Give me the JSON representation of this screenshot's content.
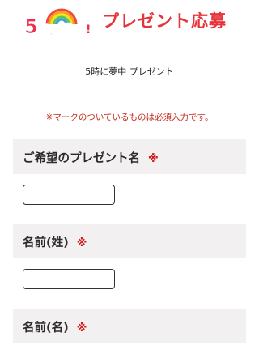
{
  "header": {
    "logo_text": "5時に夢中!",
    "title": "プレゼント応募"
  },
  "program_label": "5時に夢中 プレゼント",
  "notice": "※マークのついているものは必須入力です。",
  "form": {
    "required_mark": "※",
    "sections": [
      {
        "label": "ご希望のプレゼント名",
        "value": ""
      },
      {
        "label": "名前(姓)",
        "value": ""
      },
      {
        "label": "名前(名)",
        "value": ""
      }
    ]
  },
  "colors": {
    "accent_red": "#e5353b",
    "section_bg": "#f2f0f0"
  }
}
